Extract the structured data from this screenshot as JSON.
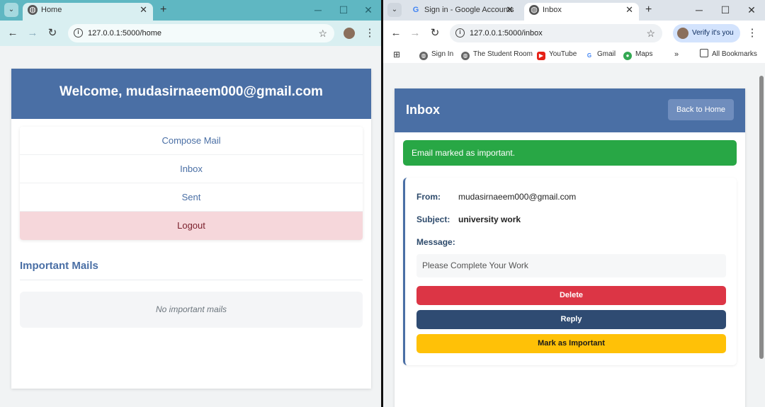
{
  "left_browser": {
    "tab_title": "Home",
    "url": "127.0.0.1:5000/home",
    "page": {
      "welcome": "Welcome, mudasirnaeem000@gmail.com",
      "menu": [
        "Compose Mail",
        "Inbox",
        "Sent",
        "Logout"
      ],
      "important_heading": "Important Mails",
      "no_important": "No important mails"
    }
  },
  "right_browser": {
    "tabs": [
      "Sign in - Google Accounts",
      "Inbox"
    ],
    "url": "127.0.0.1:5000/inbox",
    "profile_label": "Verify it's you",
    "bookmarks": [
      "Sign In",
      "The Student Room",
      "YouTube",
      "Gmail",
      "Maps",
      "All Bookmarks"
    ],
    "page": {
      "title": "Inbox",
      "back_button": "Back to Home",
      "alert": "Email marked as important.",
      "from_label": "From:",
      "from_value": "mudasirnaeem000@gmail.com",
      "subject_label": "Subject:",
      "subject_value": "university work",
      "message_label": "Message:",
      "message_value": "Please Complete Your Work",
      "delete_button": "Delete",
      "reply_button": "Reply",
      "important_button": "Mark as Important"
    }
  },
  "colors": {
    "primary": "#4a6fa5",
    "success": "#28a745",
    "danger": "#dc3545",
    "dark": "#2f4b72",
    "warning": "#ffc107",
    "logout_bg": "#f6d7db"
  },
  "icons": [
    "globe-icon",
    "google-icon",
    "back-arrow-icon",
    "forward-arrow-icon",
    "reload-icon",
    "info-icon",
    "star-icon",
    "youtube-icon",
    "maps-pin-icon",
    "folder-icon"
  ]
}
